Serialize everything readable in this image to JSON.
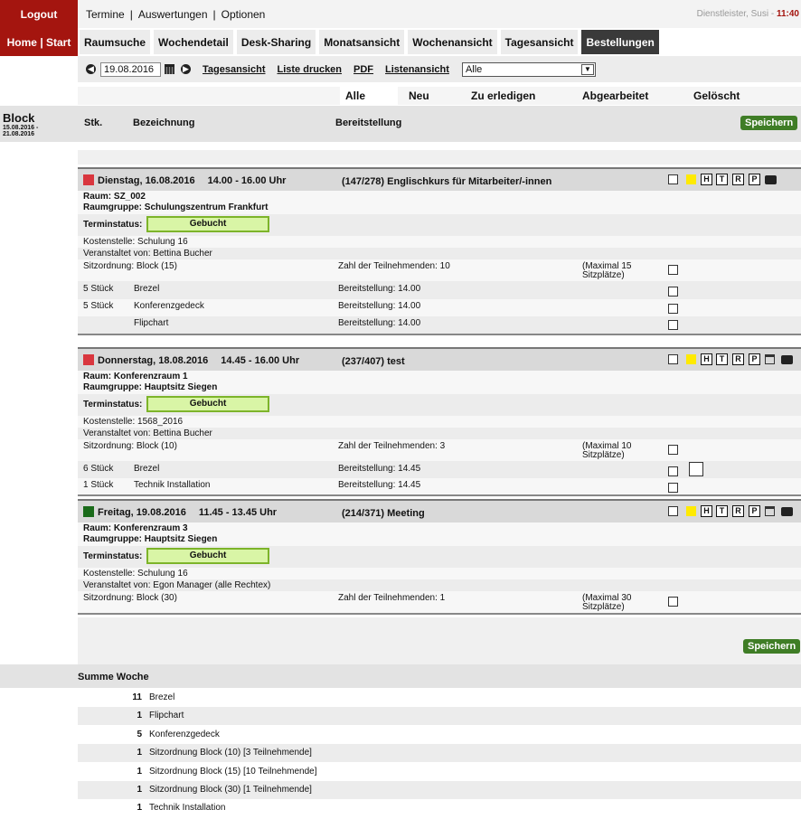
{
  "header": {
    "logout": "Logout",
    "home": "Home | Start",
    "nav": [
      "Termine",
      "Auswertungen",
      "Optionen"
    ],
    "user_name": "Dienstleister, Susi - ",
    "time": "11:40"
  },
  "tabs": [
    "Raumsuche",
    "Wochendetail",
    "Desk-Sharing",
    "Monatsansicht",
    "Wochenansicht",
    "Tagesansicht",
    "Bestellungen"
  ],
  "toolbar": {
    "date": "19.08.2016",
    "links": [
      "Tagesansicht",
      "Liste drucken",
      "PDF",
      "Listenansicht"
    ],
    "select": "Alle"
  },
  "filters": [
    "Alle",
    "Neu",
    "Zu erledigen",
    "Abgearbeitet",
    "Gelöscht"
  ],
  "sidebar": {
    "title": "Block",
    "range1": "15.08.2016 -",
    "range2": "21.08.2016"
  },
  "columns": {
    "stk": "Stk.",
    "bez": "Bezeichnung",
    "bereit": "Bereitstellung"
  },
  "save": "Speichern",
  "icon_letters": [
    "H",
    "T",
    "R",
    "P"
  ],
  "labels": {
    "raum": "Raum:",
    "raumgruppe": "Raumgruppe:",
    "terminstatus": "Terminstatus:"
  },
  "bookings": [
    {
      "color": "#d9363e",
      "date": "Dienstag, 16.08.2016",
      "time": "14.00 - 16.00 Uhr",
      "title": "(147/278) Englischkurs für Mitarbeiter/-innen",
      "raum": "SZ_002",
      "raumgruppe": "Schulungszentrum Frankfurt",
      "status": "Gebucht",
      "kosten": "Kostenstelle: Schulung 16",
      "veranst": "Veranstaltet von: Bettina Bucher",
      "sitz": "Sitzordnung: Block (15)",
      "teiln": "Zahl der Teilnehmenden: 10",
      "max1": "(Maximal 15",
      "max2": "Sitzplätze)",
      "items": [
        {
          "qty": "5 Stück",
          "name": "Brezel",
          "bereit": "Bereitstellung: 14.00"
        },
        {
          "qty": "5 Stück",
          "name": "Konferenzgedeck",
          "bereit": "Bereitstellung: 14.00"
        },
        {
          "qty": "",
          "name": "Flipchart",
          "bereit": "Bereitstellung: 14.00"
        }
      ]
    },
    {
      "color": "#d9363e",
      "date": "Donnerstag, 18.08.2016",
      "time": "14.45 - 16.00 Uhr",
      "title": "(237/407) test",
      "raum": "Konferenzraum 1",
      "raumgruppe": "Hauptsitz Siegen",
      "status": "Gebucht",
      "kosten": "Kostenstelle: 1568_2016",
      "veranst": "Veranstaltet von: Bettina Bucher",
      "sitz": "Sitzordnung: Block (10)",
      "teiln": "Zahl der Teilnehmenden: 3",
      "max1": "(Maximal 10",
      "max2": "Sitzplätze)",
      "items": [
        {
          "qty": "6 Stück",
          "name": "Brezel",
          "bereit": "Bereitstellung: 14.45"
        },
        {
          "qty": "1 Stück",
          "name": "Technik Installation",
          "bereit": "Bereitstellung: 14.45"
        }
      ]
    },
    {
      "color": "#1a6b1a",
      "date": "Freitag, 19.08.2016",
      "time": "11.45 - 13.45 Uhr",
      "title": "(214/371) Meeting",
      "raum": "Konferenzraum 3",
      "raumgruppe": "Hauptsitz Siegen",
      "status": "Gebucht",
      "kosten": "Kostenstelle: Schulung 16",
      "veranst": "Veranstaltet von: Egon Manager (alle Rechtex)",
      "sitz": "Sitzordnung: Block (30)",
      "teiln": "Zahl der Teilnehmenden: 1",
      "max1": "(Maximal 30",
      "max2": "Sitzplätze)",
      "items": []
    }
  ],
  "summary": {
    "title": "Summe Woche",
    "rows": [
      {
        "n": "11",
        "t": "Brezel"
      },
      {
        "n": "1",
        "t": "Flipchart"
      },
      {
        "n": "5",
        "t": "Konferenzgedeck"
      },
      {
        "n": "1",
        "t": "Sitzordnung Block (10) [3 Teilnehmende]"
      },
      {
        "n": "1",
        "t": "Sitzordnung Block (15) [10 Teilnehmende]"
      },
      {
        "n": "1",
        "t": "Sitzordnung Block (30) [1 Teilnehmende]"
      },
      {
        "n": "1",
        "t": "Technik Installation"
      }
    ]
  }
}
